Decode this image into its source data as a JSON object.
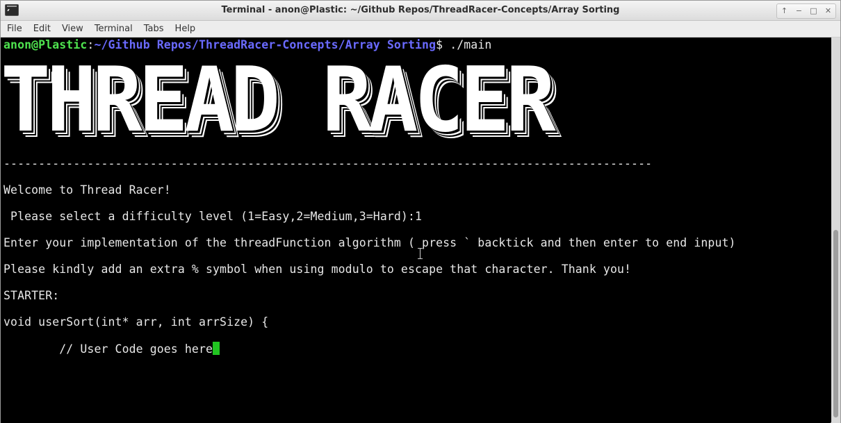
{
  "window": {
    "title": "Terminal - anon@Plastic: ~/Github Repos/ThreadRacer-Concepts/Array Sorting",
    "controls": [
      "up-arrow-icon",
      "minimize-icon",
      "maximize-icon",
      "close-icon"
    ]
  },
  "menubar": {
    "items": [
      "File",
      "Edit",
      "View",
      "Terminal",
      "Tabs",
      "Help"
    ]
  },
  "terminal": {
    "prompt": {
      "user_host": "anon@Plastic",
      "colon": ":",
      "path": "~/Github Repos/ThreadRacer-Concepts/Array Sorting",
      "dollar": "$",
      "command": " ./main"
    },
    "banner": "THREAD RACER",
    "separator": "---------------------------------------------------------------------------------------------",
    "welcome": "Welcome to Thread Racer!",
    "difficulty": " Please select a difficulty level (1=Easy,2=Medium,3=Hard):1",
    "implement": "Enter your implementation of the threadFunction algorithm ( press ` backtick and then enter to end input)",
    "modulo_note": "Please kindly add an extra % symbol when using modulo to escape that character. Thank you!",
    "starter_label": "STARTER:",
    "code_signature": "void userSort(int* arr, int arrSize) {",
    "code_comment": "        // User Code goes here"
  },
  "colors": {
    "prompt_user": "#4fe34f",
    "prompt_path": "#6a6aff",
    "cursor": "#21c421",
    "background": "#000000",
    "text": "#e8e8e8"
  }
}
